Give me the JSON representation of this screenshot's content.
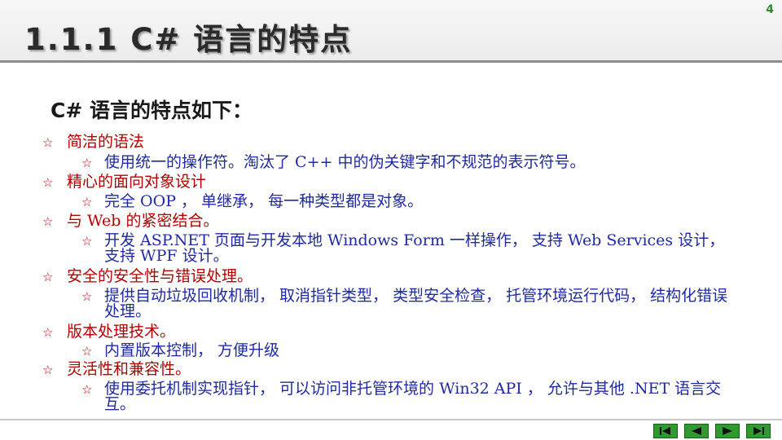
{
  "header": {
    "title": "1.1.1 C# 语言的特点",
    "page_number": "4"
  },
  "subtitle": "C# 语言的特点如下：",
  "bullet_glyph": "☆",
  "items": [
    {
      "label": "简洁的语法",
      "subs": [
        "使用统一的操作符。淘汰了 C++ 中的伪关键字和不规范的表示符号。"
      ]
    },
    {
      "label": "精心的面向对象设计",
      "subs": [
        "完全 OOP ， 单继承， 每一种类型都是对象。"
      ]
    },
    {
      "label": "与 Web 的紧密结合。",
      "subs": [
        "开发 ASP.NET 页面与开发本地  Windows Form 一样操作， 支持 Web Services 设计， 支持 WPF 设计。"
      ]
    },
    {
      "label": "安全的安全性与错误处理。",
      "subs": [
        "提供自动垃圾回收机制， 取消指针类型， 类型安全检查， 托管环境运行代码， 结构化错误处理。"
      ]
    },
    {
      "label": "版本处理技术。",
      "subs": [
        "内置版本控制， 方便升级"
      ]
    },
    {
      "label": "灵活性和兼容性。",
      "subs": [
        "使用委托机制实现指针， 可以访问非托管环境的 Win32 API ， 允许与其他 .NET 语言交互。"
      ]
    }
  ],
  "navigation": {
    "first": "first-slide-icon",
    "previous": "previous-slide-icon",
    "next": "next-slide-icon",
    "last": "last-slide-icon"
  },
  "colors": {
    "level1_text": "#b30000",
    "level2_text": "#1f2aa0",
    "nav_button": "#2f9a2f"
  }
}
